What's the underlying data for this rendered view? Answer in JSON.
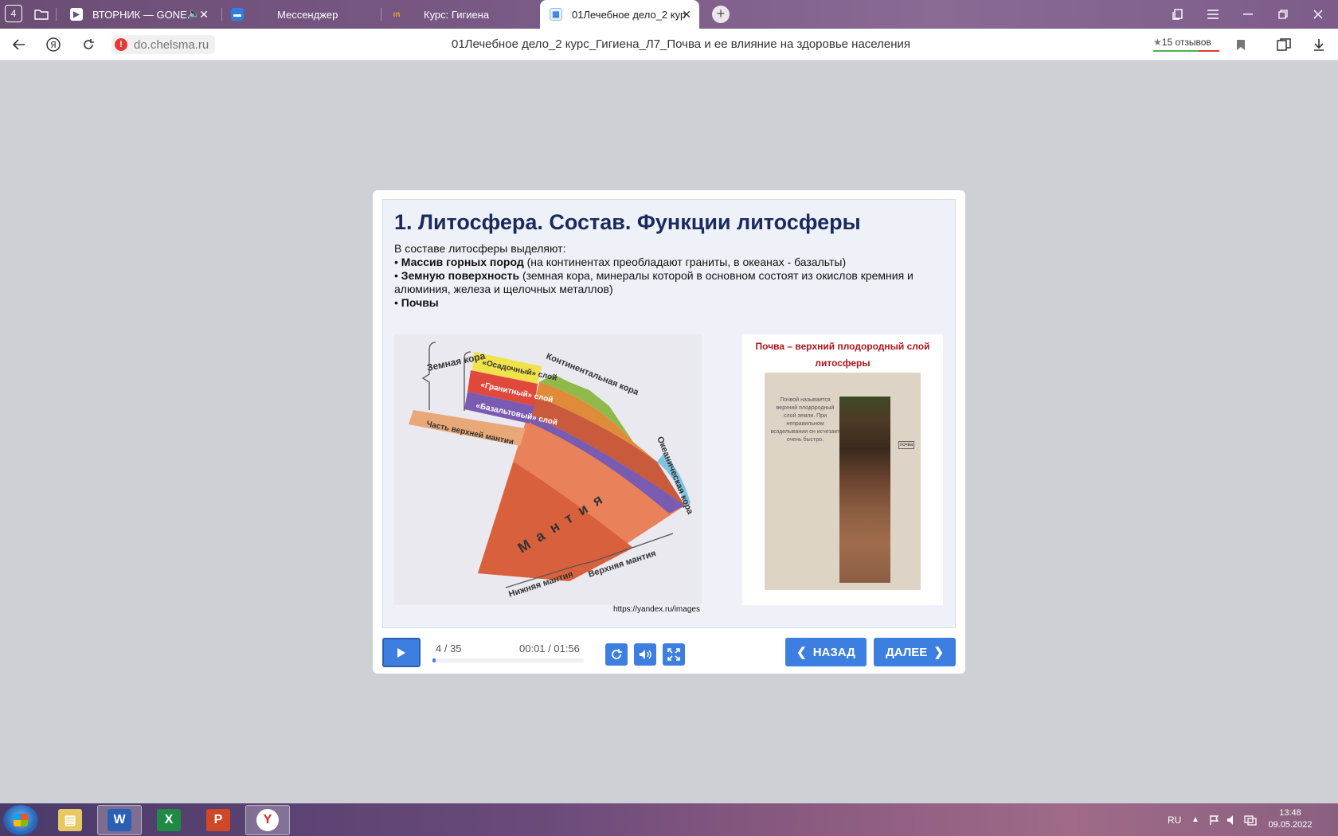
{
  "browser": {
    "tab_counter": "4",
    "tabs": [
      {
        "title": "ВТОРНИК — GONE.F",
        "close": "✕"
      },
      {
        "title": "Мессенджер"
      },
      {
        "title": "Курс: Гигиена"
      },
      {
        "title": "01Лечебное дело_2 кур",
        "close": "✕"
      }
    ],
    "new_tab": "+",
    "url": "do.chelsma.ru",
    "page_title": "01Лечебное дело_2 курс_Гигиена_Л7_Почва и ее влияние на здоровье населения",
    "reviews": "15 отзывов"
  },
  "slide": {
    "title": "1. Литосфера. Состав. Функции литосферы",
    "intro": "В составе литосферы выделяют:",
    "bullets": [
      {
        "bold": "Массив горных пород",
        "rest": " (на континентах преобладают граниты, в океанах - базальты)"
      },
      {
        "bold": "Земную поверхность",
        "rest": " (земная кора, минералы которой в основном состоят из окислов кремния и алюминия, железа и щелочных металлов)"
      },
      {
        "bold": "Почвы",
        "rest": ""
      }
    ],
    "left_image": {
      "labels": {
        "crust": "Земная кора",
        "sedimentary": "«Осадочный» слой",
        "granite": "«Гранитный» слой",
        "basalt": "«Базальтовый» слой",
        "upper_mantle_part": "Часть верхней мантии",
        "continental": "Континентальная кора",
        "oceanic": "Океаническая кора",
        "mantle": "М а н т и я",
        "lower_mantle": "Нижняя мантия",
        "upper_mantle": "Верхняя мантия"
      },
      "caption": "https://yandex.ru/images"
    },
    "right_image": {
      "heading_line1": "Почва – верхний плодородный слой",
      "heading_line2": "литосферы",
      "note": "Почвой называется верхний плодородный слой земли. При неправильном возделывании он исчезает очень быстро.",
      "label": "почва"
    }
  },
  "controls": {
    "slide_count": "4 / 35",
    "time": "00:01 / 01:56",
    "progress": 0.01,
    "back": "НАЗАД",
    "next": "ДАЛЕЕ"
  },
  "taskbar": {
    "lang": "RU",
    "time": "13:48",
    "date": "09.05.2022"
  },
  "colors": {
    "accent": "#3d7fe0",
    "title": "#1a2a5e",
    "soil_heading": "#b0141c"
  }
}
